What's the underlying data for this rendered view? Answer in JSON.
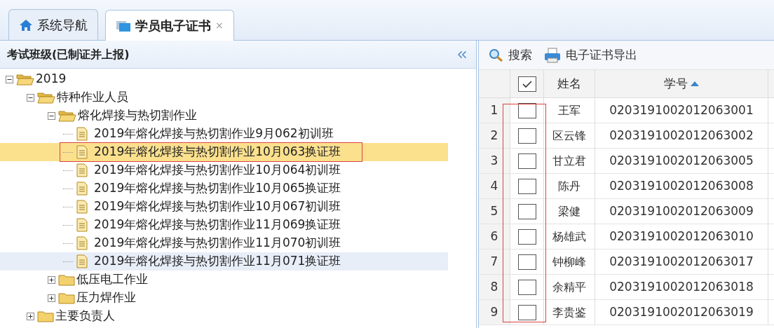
{
  "tabs": [
    {
      "label": "系统导航",
      "selected": false
    },
    {
      "label": "学员电子证书",
      "selected": true,
      "close": "×"
    }
  ],
  "tree": {
    "title": "考试班级(已制证并上报)",
    "items": [
      {
        "label": "2019",
        "kind": "folder",
        "expanded": true,
        "children": [
          {
            "label": "特种作业人员",
            "kind": "folder",
            "expanded": true,
            "children": [
              {
                "label": "熔化焊接与热切割作业",
                "kind": "folder",
                "expanded": true,
                "children": [
                  {
                    "label": "2019年熔化焊接与热切割作业9月062初训班",
                    "kind": "file",
                    "selected": false,
                    "hovered": false,
                    "outlined": false
                  },
                  {
                    "label": "2019年熔化焊接与热切割作业10月063换证班",
                    "kind": "file",
                    "selected": true,
                    "hovered": false,
                    "outlined": true
                  },
                  {
                    "label": "2019年熔化焊接与热切割作业10月064初训班",
                    "kind": "file",
                    "selected": false,
                    "hovered": false,
                    "outlined": false
                  },
                  {
                    "label": "2019年熔化焊接与热切割作业10月065换证班",
                    "kind": "file",
                    "selected": false,
                    "hovered": false,
                    "outlined": false
                  },
                  {
                    "label": "2019年熔化焊接与热切割作业10月067初训班",
                    "kind": "file",
                    "selected": false,
                    "hovered": false,
                    "outlined": false
                  },
                  {
                    "label": "2019年熔化焊接与热切割作业11月069换证班",
                    "kind": "file",
                    "selected": false,
                    "hovered": false,
                    "outlined": false
                  },
                  {
                    "label": "2019年熔化焊接与热切割作业11月070初训班",
                    "kind": "file",
                    "selected": false,
                    "hovered": false,
                    "outlined": false
                  },
                  {
                    "label": "2019年熔化焊接与热切割作业11月071换证班",
                    "kind": "file",
                    "selected": false,
                    "hovered": true,
                    "outlined": false
                  }
                ]
              },
              {
                "label": "低压电工作业",
                "kind": "folder",
                "expanded": false
              },
              {
                "label": "压力焊作业",
                "kind": "folder",
                "expanded": false
              }
            ]
          },
          {
            "label": "主要负责人",
            "kind": "folder",
            "expanded": false
          }
        ]
      }
    ]
  },
  "toolbar": [
    {
      "label": "搜索"
    },
    {
      "label": "电子证书导出"
    }
  ],
  "table": {
    "all_checked": true,
    "checkbox_column_outlined": true,
    "columns": [
      {
        "label": "姓名",
        "sort_ascending": false
      },
      {
        "label": "学号",
        "sort_ascending": true
      }
    ],
    "rows": [
      {
        "number": "1",
        "checked": false,
        "name": "王军",
        "id": "0203191002012063001"
      },
      {
        "number": "2",
        "checked": false,
        "name": "区云锋",
        "id": "0203191002012063002"
      },
      {
        "number": "3",
        "checked": false,
        "name": "甘立君",
        "id": "0203191002012063005"
      },
      {
        "number": "4",
        "checked": false,
        "name": "陈丹",
        "id": "0203191002012063008"
      },
      {
        "number": "5",
        "checked": false,
        "name": "梁健",
        "id": "0203191002012063009"
      },
      {
        "number": "6",
        "checked": false,
        "name": "杨雄武",
        "id": "0203191002012063010"
      },
      {
        "number": "7",
        "checked": false,
        "name": "钟柳峰",
        "id": "0203191002012063017"
      },
      {
        "number": "8",
        "checked": false,
        "name": "余精平",
        "id": "0203191002012063018"
      },
      {
        "number": "9",
        "checked": false,
        "name": "李贵鉴",
        "id": "0203191002012063019"
      }
    ]
  }
}
